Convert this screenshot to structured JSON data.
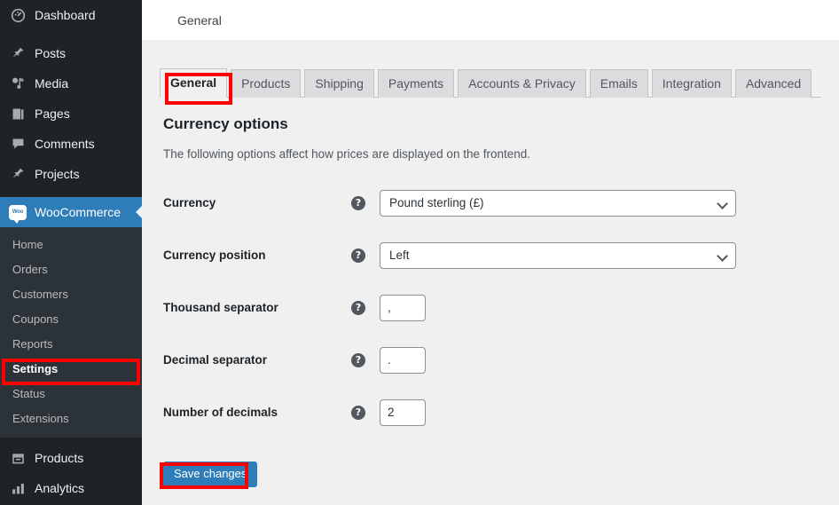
{
  "sidebar": {
    "items": [
      {
        "label": "Dashboard",
        "icon": "dashboard-icon"
      },
      {
        "label": "Posts",
        "icon": "pin-icon"
      },
      {
        "label": "Media",
        "icon": "media-icon"
      },
      {
        "label": "Pages",
        "icon": "pages-icon"
      },
      {
        "label": "Comments",
        "icon": "comment-icon"
      },
      {
        "label": "Projects",
        "icon": "pin-icon"
      }
    ],
    "woocommerce": {
      "label": "WooCommerce",
      "logo_text": "Woo",
      "highlight_color": "#2e7cb8"
    },
    "submenu": [
      {
        "label": "Home"
      },
      {
        "label": "Orders"
      },
      {
        "label": "Customers"
      },
      {
        "label": "Coupons"
      },
      {
        "label": "Reports"
      },
      {
        "label": "Settings"
      },
      {
        "label": "Status"
      },
      {
        "label": "Extensions"
      }
    ],
    "bottom_items": [
      {
        "label": "Products",
        "icon": "products-icon"
      },
      {
        "label": "Analytics",
        "icon": "analytics-icon"
      }
    ]
  },
  "header": {
    "page_title": "General"
  },
  "tabs": [
    {
      "label": "General",
      "active": true
    },
    {
      "label": "Products",
      "active": false
    },
    {
      "label": "Shipping",
      "active": false
    },
    {
      "label": "Payments",
      "active": false
    },
    {
      "label": "Accounts & Privacy",
      "active": false
    },
    {
      "label": "Emails",
      "active": false
    },
    {
      "label": "Integration",
      "active": false
    },
    {
      "label": "Advanced",
      "active": false
    }
  ],
  "section": {
    "title": "Currency options",
    "description": "The following options affect how prices are displayed on the frontend."
  },
  "fields": [
    {
      "label": "Currency",
      "value": "Pound sterling (£)",
      "type": "select",
      "help": "?"
    },
    {
      "label": "Currency position",
      "value": "Left",
      "type": "select",
      "help": "?"
    },
    {
      "label": "Thousand separator",
      "value": ",",
      "type": "text",
      "help": "?"
    },
    {
      "label": "Decimal separator",
      "value": ".",
      "type": "text",
      "help": "?"
    },
    {
      "label": "Number of decimals",
      "value": "2",
      "type": "text",
      "help": "?"
    }
  ],
  "actions": {
    "save_label": "Save changes"
  },
  "annotations": {
    "color": "#ff0000"
  }
}
